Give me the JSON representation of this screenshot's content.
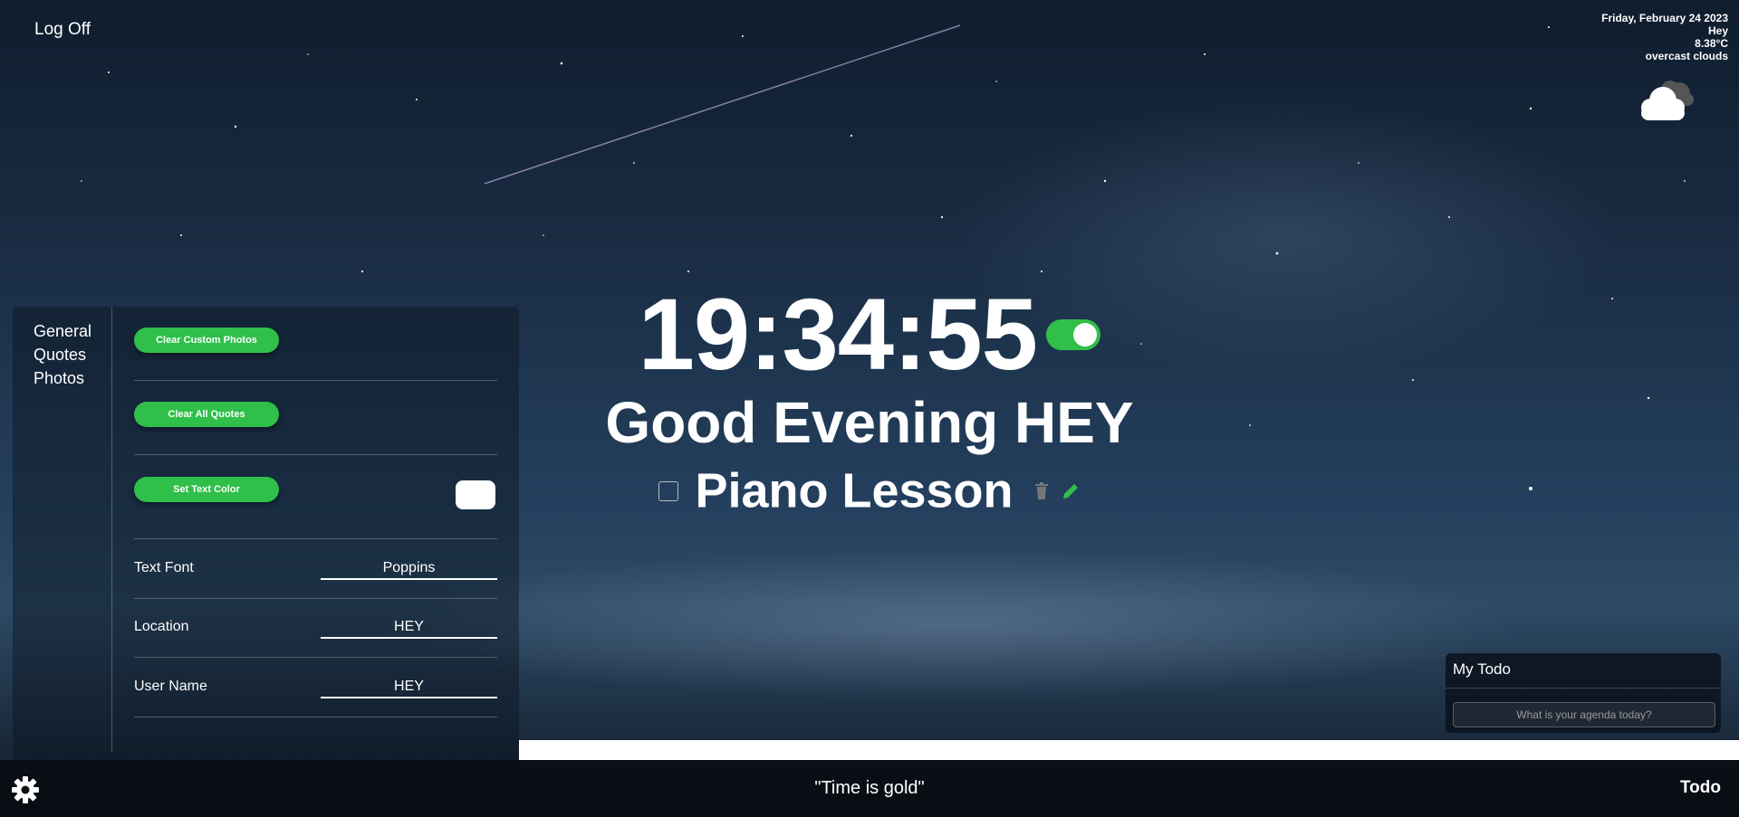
{
  "header": {
    "log_off": "Log Off"
  },
  "weather": {
    "date": "Friday, February 24 2023",
    "location": "Hey",
    "temperature": "8.38°C",
    "description": "overcast clouds",
    "icon": "cloud-icon"
  },
  "clock": {
    "time": "19:34:55",
    "toggle_on": true
  },
  "greeting": "Good Evening HEY",
  "focus": {
    "text": "Piano Lesson"
  },
  "settings": {
    "nav": [
      "General",
      "Quotes",
      "Photos"
    ],
    "buttons": {
      "clear_custom_photos": "Clear Custom Photos",
      "clear_all_quotes": "Clear All Quotes",
      "set_text_color": "Set Text Color"
    },
    "text_color": "#ffffff",
    "fields": {
      "text_font": {
        "label": "Text Font",
        "value": "Poppins"
      },
      "location": {
        "label": "Location",
        "value": "HEY"
      },
      "user_name": {
        "label": "User Name",
        "value": "HEY"
      }
    }
  },
  "todo": {
    "title": "My Todo",
    "placeholder": "What is your agenda today?"
  },
  "footer": {
    "quote": "\"Time is gold\"",
    "todo_link": "Todo"
  },
  "colors": {
    "accent_green": "#2fbf4a"
  }
}
